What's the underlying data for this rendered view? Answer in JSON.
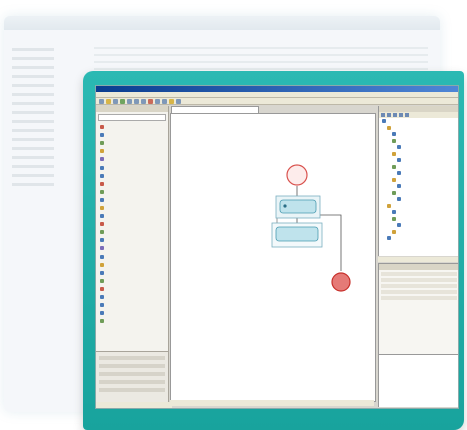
{
  "window": {
    "title": "",
    "menu": [
      "",
      "",
      "",
      "",
      "",
      "",
      "",
      ""
    ]
  },
  "palette": {
    "header": "",
    "items": [
      {
        "label": "",
        "icon": "start-icon",
        "color": "#c85a4a"
      },
      {
        "label": "",
        "icon": "task-icon",
        "color": "#4a7ab8"
      },
      {
        "label": "",
        "icon": "gear-icon",
        "color": "#6f9c58"
      },
      {
        "label": "",
        "icon": "user-icon",
        "color": "#d0a23a"
      },
      {
        "label": "",
        "icon": "decision-icon",
        "color": "#7b6cb8"
      },
      {
        "label": "",
        "icon": "fork-icon",
        "color": "#4a7ab8"
      },
      {
        "label": "",
        "icon": "join-icon",
        "color": "#4a7ab8"
      },
      {
        "label": "",
        "icon": "mail-icon",
        "color": "#c85a4a"
      },
      {
        "label": "",
        "icon": "timer-icon",
        "color": "#6f9c58"
      },
      {
        "label": "",
        "icon": "script-icon",
        "color": "#4a7ab8"
      },
      {
        "label": "",
        "icon": "subprocess-icon",
        "color": "#d0a23a"
      },
      {
        "label": "",
        "icon": "node-icon",
        "color": "#4a7ab8"
      },
      {
        "label": "",
        "icon": "state-icon",
        "color": "#c85a4a"
      },
      {
        "label": "",
        "icon": "transition-icon",
        "color": "#6f9c58"
      },
      {
        "label": "",
        "icon": "note-icon",
        "color": "#4a7ab8"
      },
      {
        "label": "",
        "icon": "variable-icon",
        "color": "#7b6cb8"
      },
      {
        "label": "",
        "icon": "action-icon",
        "color": "#4a7ab8"
      },
      {
        "label": "",
        "icon": "event-icon",
        "color": "#d0a23a"
      },
      {
        "label": "",
        "icon": "swimlane-icon",
        "color": "#4a7ab8"
      },
      {
        "label": "",
        "icon": "group-icon",
        "color": "#6f9c58"
      },
      {
        "label": "",
        "icon": "end-icon",
        "color": "#c85a4a"
      },
      {
        "label": "",
        "icon": "list-icon",
        "color": "#4a7ab8"
      },
      {
        "label": "",
        "icon": "form-icon",
        "color": "#4a7ab8"
      },
      {
        "label": "",
        "icon": "text-icon",
        "color": "#4a7ab8"
      },
      {
        "label": "",
        "icon": "rule-icon",
        "color": "#6f9c58"
      }
    ]
  },
  "editor": {
    "tab_label": "",
    "status": "",
    "nodes": {
      "start": "",
      "task_1": "",
      "task_2": "",
      "end": ""
    }
  },
  "tree": {
    "header": "",
    "rows": [
      {
        "label": "",
        "depth": 0,
        "color": "#4a7ab8"
      },
      {
        "label": "",
        "depth": 1,
        "color": "#d0a23a"
      },
      {
        "label": "",
        "depth": 2,
        "color": "#4a7ab8"
      },
      {
        "label": "",
        "depth": 2,
        "color": "#6f9c58"
      },
      {
        "label": "",
        "depth": 3,
        "color": "#4a7ab8"
      },
      {
        "label": "",
        "depth": 2,
        "color": "#d0a23a"
      },
      {
        "label": "",
        "depth": 3,
        "color": "#4a7ab8"
      },
      {
        "label": "",
        "depth": 2,
        "color": "#6f9c58"
      },
      {
        "label": "",
        "depth": 3,
        "color": "#4a7ab8"
      },
      {
        "label": "",
        "depth": 2,
        "color": "#d0a23a"
      },
      {
        "label": "",
        "depth": 3,
        "color": "#4a7ab8"
      },
      {
        "label": "",
        "depth": 2,
        "color": "#6f9c58"
      },
      {
        "label": "",
        "depth": 3,
        "color": "#4a7ab8"
      },
      {
        "label": "",
        "depth": 1,
        "color": "#d0a23a"
      },
      {
        "label": "",
        "depth": 2,
        "color": "#4a7ab8"
      },
      {
        "label": "",
        "depth": 2,
        "color": "#6f9c58"
      },
      {
        "label": "",
        "depth": 3,
        "color": "#4a7ab8"
      },
      {
        "label": "",
        "depth": 2,
        "color": "#d0a23a"
      },
      {
        "label": "",
        "depth": 1,
        "color": "#4a7ab8"
      }
    ]
  },
  "properties": {
    "header": ""
  },
  "colors": {
    "frame": "#1fafa9",
    "start_node": "#d9534f",
    "end_node": "#d9534f",
    "task_fill": "#bfe3ec",
    "task_stroke": "#4a9bb0"
  }
}
